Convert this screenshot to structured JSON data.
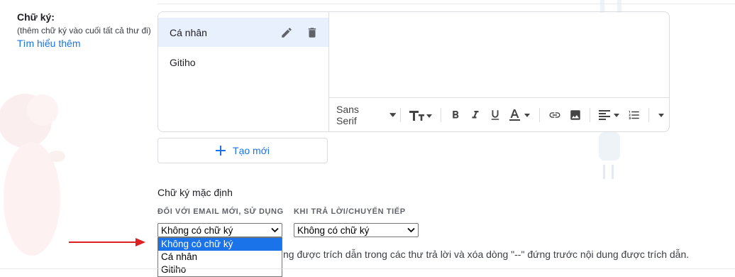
{
  "section": {
    "title": "Chữ ký:",
    "hint": "(thêm chữ ký vào cuối tất cả thư đi)",
    "learn_more": "Tìm hiểu thêm"
  },
  "signatures": {
    "items": [
      {
        "name": "Cá nhân",
        "selected": true
      },
      {
        "name": "Gitiho",
        "selected": false
      }
    ],
    "edit_icon": "pencil-icon",
    "delete_icon": "trash-icon"
  },
  "toolbar": {
    "font": "Sans Serif",
    "icons": [
      "font-size-icon",
      "bold-icon",
      "italic-icon",
      "underline-icon",
      "text-color-icon",
      "link-icon",
      "image-icon",
      "align-icon",
      "numbered-list-icon",
      "more-options-icon"
    ]
  },
  "create_button": {
    "label": "Tạo mới",
    "icon": "plus-icon"
  },
  "defaults": {
    "title": "Chữ ký mặc định",
    "new_email_label": "ĐỐI VỚI EMAIL MỚI, SỬ DỤNG",
    "reply_label": "KHI TRẢ LỜI/CHUYỂN TIẾP",
    "new_email_value": "Không có chữ ký",
    "reply_value": "Không có chữ ký",
    "options": [
      "Không có chữ ký",
      "Cá nhân",
      "Gitiho"
    ],
    "note": "ng được trích dẫn trong các thư trả lời và xóa dòng \"--\" đứng trước nội dung được trích dẫn."
  },
  "colors": {
    "accent": "#1a73e8",
    "selected_bg": "#e8f0fe",
    "annotation_arrow": "#e02020"
  }
}
